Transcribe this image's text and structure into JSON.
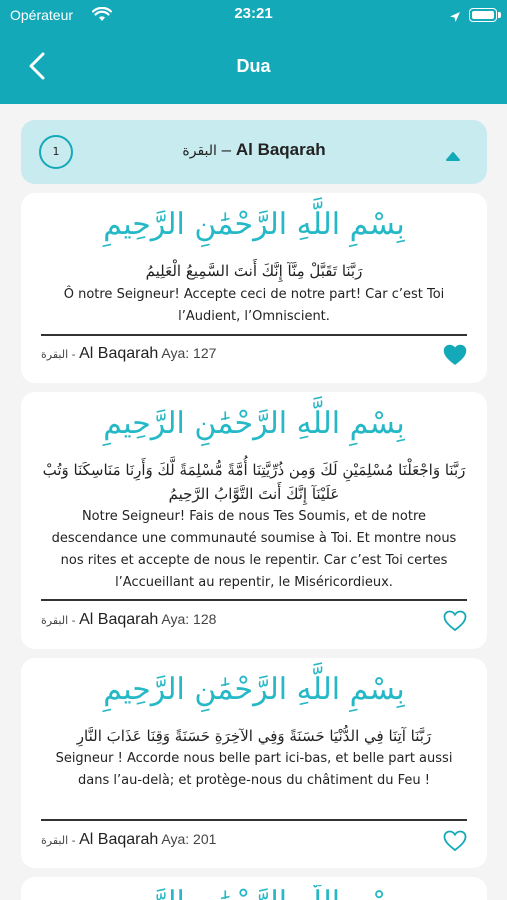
{
  "status_bar": {
    "carrier": "Opérateur",
    "time": "23:21"
  },
  "header": {
    "title": "Dua"
  },
  "section": {
    "number": "1",
    "arabic_name": "البقرة",
    "separator": " – ",
    "name": "Al Baqarah"
  },
  "bismillah": "بِسْمِ اللَّهِ الرَّحْمَٰنِ الرَّحِيمِ",
  "colors": {
    "accent": "#14a9b8",
    "section_bg": "#c7ebef"
  },
  "duas": [
    {
      "arabic": "رَبَّنَا تَقَبَّلْ مِنَّآ إِنَّكَ أَنتَ السَّمِيعُ الْعَلِيمُ",
      "translation": "Ô notre Seigneur! Accepte ceci de notre part! Car c’est Toi l’Audient, l’Omniscient.",
      "surah_ar": "البقرة",
      "separator": " - ",
      "surah": "Al Baqarah",
      "aya": "Aya: 127",
      "favorite": true
    },
    {
      "arabic": "رَبَّنَا وَاجْعَلْنَا مُسْلِمَيْنِ لَكَ وَمِن ذُرِّيَّتِنَا أُمَّةً مُّسْلِمَةً لَّكَ وَأَرِنَا مَنَاسِكَنَا وَتُبْ عَلَيْنَآ إِنَّكَ أَنتَ التَّوَّابُ الرَّحِيمُ",
      "translation": "Notre Seigneur! Fais de nous Tes Soumis, et de notre descendance une communauté soumise à Toi. Et montre nous nos rites et accepte de nous le repentir. Car c’est Toi certes l’Accueillant au repentir, le Miséricordieux.",
      "surah_ar": "البقرة",
      "separator": " - ",
      "surah": "Al Baqarah",
      "aya": "Aya: 128",
      "favorite": false
    },
    {
      "arabic": "رَبَّنَا آتِنَا فِي الدُّنْيَا حَسَنَةً وَفِي الآخِرَةِ حَسَنَةً وَقِنَا عَذَابَ النَّارِ",
      "translation": "Seigneur ! Accorde nous belle part ici-bas, et belle part aussi dans l’au-delà; et protège-nous du châtiment du Feu !",
      "surah_ar": "البقرة",
      "separator": " - ",
      "surah": "Al Baqarah",
      "aya": "Aya: 201",
      "favorite": false
    }
  ]
}
